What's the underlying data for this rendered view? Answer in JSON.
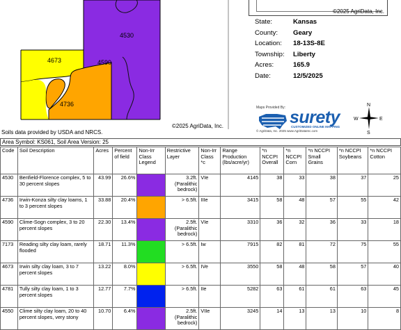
{
  "map": {
    "labels": {
      "a": "4530",
      "b": "4673",
      "c": "4590",
      "d": "4736"
    },
    "copyright": "©2025 AgriData, Inc.",
    "colors": {
      "purple": "#8a2be2",
      "yellow": "#ffff00",
      "orange": "#ffa500"
    }
  },
  "mini_map": {
    "copyright": "©2025 AgriData, Inc."
  },
  "info": [
    {
      "key": "State:",
      "value": "Kansas"
    },
    {
      "key": "County:",
      "value": "Geary"
    },
    {
      "key": "Location:",
      "value": "18-13S-8E"
    },
    {
      "key": "Township:",
      "value": "Liberty"
    },
    {
      "key": "Acres:",
      "value": "165.9"
    },
    {
      "key": "Date:",
      "value": "12/5/2025"
    }
  ],
  "logo": {
    "provided_by": "Maps Provided By:",
    "word": "surety",
    "tagline": "CUSTOMIZED ONLINE MAPPING",
    "footer": "© AgriData, Inc. 2025        www.AgriDataInc.com",
    "brand_color": "#1b5fb0"
  },
  "compass": {
    "n": "N",
    "s": "S",
    "e": "E",
    "w": "W"
  },
  "source_note": "Soils data provided by USDA and NRCS.",
  "area_symbol": "Area Symbol: KS061, Soil Area Version: 25",
  "table": {
    "headers": {
      "code": "Code",
      "desc": "Soil Description",
      "acres": "Acres",
      "pct": "Percent of field",
      "legend": "Non-Irr Class Legend",
      "restrict": "Restrictive Layer",
      "cls": "Non-Irr Class *c",
      "range": "Range Production (lbs/acre/yr)",
      "overall": "*n NCCPI Overall",
      "corn": "*n NCCPI Corn",
      "grains": "*n NCCPI Small Grains",
      "soy": "*n NCCPI Soybeans",
      "cotton": "*n NCCPI Cotton"
    },
    "rows": [
      {
        "code": "4530",
        "desc": "Benfield-Florence complex, 5 to 30 percent slopes",
        "acres": "43.99",
        "pct": "26.6%",
        "color": "#8a2be2",
        "restrict": "3.2ft. (Paralithic bedrock)",
        "cls": "VIe",
        "range": "4145",
        "overall": "38",
        "corn": "33",
        "grains": "38",
        "soy": "37",
        "cotton": "25"
      },
      {
        "code": "4736",
        "desc": "Irwin-Konza silty clay loams, 1 to 3 percent slopes",
        "acres": "33.88",
        "pct": "20.4%",
        "color": "#ffa500",
        "restrict": "> 6.5ft.",
        "cls": "IIIe",
        "range": "3415",
        "overall": "58",
        "corn": "48",
        "grains": "57",
        "soy": "55",
        "cotton": "42"
      },
      {
        "code": "4590",
        "desc": "Clime-Sogn complex, 3 to 20 percent slopes",
        "acres": "22.30",
        "pct": "13.4%",
        "color": "#8a2be2",
        "restrict": "2.5ft. (Paralithic bedrock)",
        "cls": "VIe",
        "range": "3310",
        "overall": "36",
        "corn": "32",
        "grains": "36",
        "soy": "33",
        "cotton": "18"
      },
      {
        "code": "7173",
        "desc": "Reading silty clay loam, rarely flooded",
        "acres": "18.71",
        "pct": "11.3%",
        "color": "#22dd22",
        "restrict": "> 6.5ft.",
        "cls": "Iw",
        "range": "7915",
        "overall": "82",
        "corn": "81",
        "grains": "72",
        "soy": "75",
        "cotton": "55"
      },
      {
        "code": "4673",
        "desc": "Irwin silty clay loam, 3 to 7 percent slopes",
        "acres": "13.22",
        "pct": "8.0%",
        "color": "#ffff00",
        "restrict": "> 6.5ft.",
        "cls": "IVe",
        "range": "3550",
        "overall": "58",
        "corn": "48",
        "grains": "58",
        "soy": "57",
        "cotton": "40"
      },
      {
        "code": "4781",
        "desc": "Tully silty clay loam, 1 to 3 percent slopes",
        "acres": "12.77",
        "pct": "7.7%",
        "color": "#0022ee",
        "restrict": "> 6.5ft.",
        "cls": "IIe",
        "range": "5282",
        "overall": "63",
        "corn": "61",
        "grains": "61",
        "soy": "63",
        "cotton": "45"
      },
      {
        "code": "4550",
        "desc": "Clime silty clay loam, 20 to 40 percent slopes, very stony",
        "acres": "10.70",
        "pct": "6.4%",
        "color": "#8a2be2",
        "restrict": "2.5ft. (Paralithic bedrock)",
        "cls": "VIIe",
        "range": "3245",
        "overall": "14",
        "corn": "13",
        "grains": "13",
        "soy": "10",
        "cotton": "8"
      }
    ]
  }
}
